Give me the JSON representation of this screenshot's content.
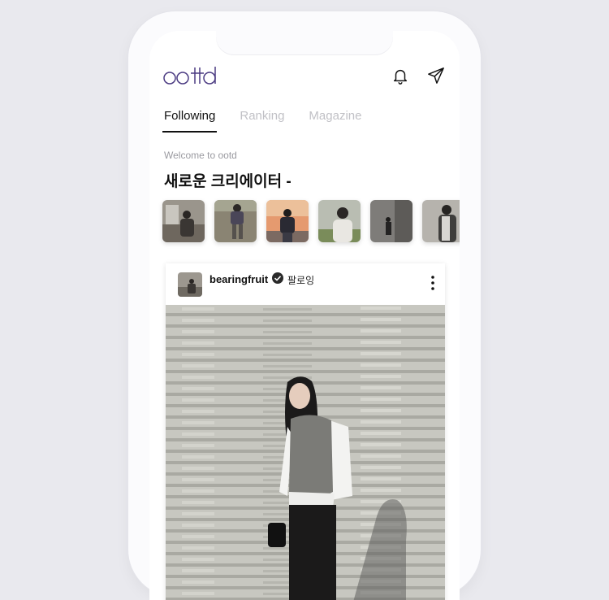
{
  "app": {
    "logo_text": "ootd",
    "accent_color": "#4b3b82",
    "icons": [
      "notification-bell-icon",
      "send-icon"
    ]
  },
  "tabs": [
    {
      "label": "Following",
      "active": true
    },
    {
      "label": "Ranking",
      "active": false
    },
    {
      "label": "Magazine",
      "active": false
    }
  ],
  "feed": {
    "welcome": "Welcome to ootd",
    "headline": "새로운 크리에이터 -"
  },
  "post": {
    "username": "bearingfruit",
    "follow_status": "팔로잉",
    "verified_icon": "verified-check-icon",
    "more_icon": "more-vertical-icon"
  }
}
